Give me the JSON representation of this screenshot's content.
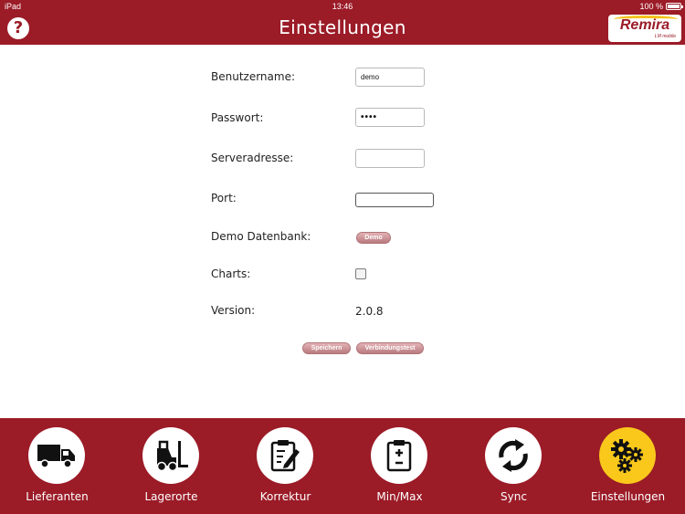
{
  "status_bar": {
    "device": "iPad",
    "time": "13:46",
    "battery": "100 %"
  },
  "header": {
    "title": "Einstellungen",
    "help_label": "?",
    "logo_text": "Remira",
    "logo_sub": "LM mobile"
  },
  "form": {
    "username_label": "Benutzername:",
    "username_value": "demo",
    "password_label": "Passwort:",
    "password_mask": "••••",
    "server_label": "Serveradresse:",
    "server_value": "",
    "port_label": "Port:",
    "port_value": "",
    "demo_db_label": "Demo Datenbank:",
    "demo_button": "Demo",
    "charts_label": "Charts:",
    "charts_checked": false,
    "version_label": "Version:",
    "version_value": "2.0.8",
    "save_button": "Speichern",
    "test_button": "Verbindungstest"
  },
  "tabs": [
    {
      "label": "Lieferanten",
      "icon": "truck-icon"
    },
    {
      "label": "Lagerorte",
      "icon": "forklift-icon"
    },
    {
      "label": "Korrektur",
      "icon": "edit-clipboard-icon"
    },
    {
      "label": "Min/Max",
      "icon": "plus-minus-clipboard-icon"
    },
    {
      "label": "Sync",
      "icon": "sync-icon"
    },
    {
      "label": "Einstellungen",
      "icon": "gears-icon",
      "active": true
    }
  ],
  "colors": {
    "brand": "#9b1b27",
    "active_tab": "#f9c81b",
    "button": "#c48a8e"
  }
}
